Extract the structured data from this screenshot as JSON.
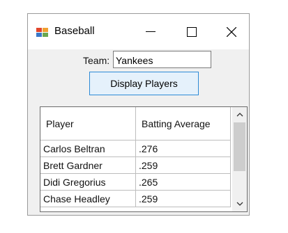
{
  "window": {
    "title": "Baseball",
    "icon": "baseball-app-icon",
    "controls": {
      "minimize": "minimize-icon",
      "maximize": "maximize-icon",
      "close": "close-icon"
    }
  },
  "form": {
    "team_label": "Team:",
    "team_value": "Yankees",
    "display_button": "Display Players"
  },
  "table": {
    "headers": [
      "Player",
      "Batting Average"
    ],
    "rows": [
      [
        "Carlos Beltran",
        ".276"
      ],
      [
        "Brett Gardner",
        ".259"
      ],
      [
        "Didi Gregorius",
        ".265"
      ],
      [
        "Chase Headley",
        ".259"
      ]
    ]
  },
  "colors": {
    "button_bg": "#e5f1fb",
    "button_border": "#2c8ad6",
    "window_bg": "#f0f0f0"
  }
}
